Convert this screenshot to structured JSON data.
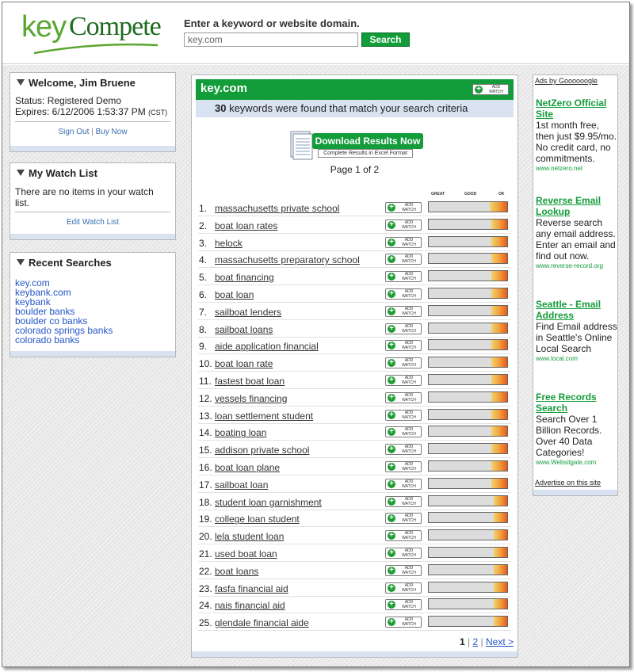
{
  "header": {
    "logo_key": "key",
    "logo_compete": "Compete",
    "search_label": "Enter a keyword or website domain.",
    "search_value": "key.com",
    "search_button": "Search"
  },
  "welcome": {
    "title": "Welcome, Jim Bruene",
    "status_line": "Status:  Registered Demo",
    "expires_line": "Expires: 6/12/2006 1:53:37 PM",
    "tz": "(CST)",
    "sign_out": "Sign Out",
    "separator": "|",
    "buy_now": "Buy Now"
  },
  "watchlist": {
    "title": "My Watch List",
    "empty_text": "There are no items in your watch list.",
    "edit_link": "Edit Watch List"
  },
  "recent": {
    "title": "Recent Searches",
    "items": [
      "key.com",
      "keybank.com",
      "keybank",
      "boulder banks",
      "boulder co banks",
      "colorado springs banks",
      "colorado banks"
    ]
  },
  "results": {
    "domain": "key.com",
    "add_watch_l1": "ADD",
    "add_watch_l2": "WATCH",
    "count": "30",
    "count_suffix": " keywords were found that match your search criteria",
    "download_button": "Download Results Now",
    "download_sub": "Complete Results in Excel Format",
    "page_text": "Page 1 of 2",
    "meter_labels": [
      "GREAT",
      "GOOD",
      "OK"
    ],
    "rows": [
      {
        "num": "1.",
        "kw": "massachusetts private school",
        "level": 0.22
      },
      {
        "num": "2.",
        "kw": "boat loan rates",
        "level": 0.2
      },
      {
        "num": "3.",
        "kw": "helock",
        "level": 0.2
      },
      {
        "num": "4.",
        "kw": "massachusetts preparatory school",
        "level": 0.2
      },
      {
        "num": "5.",
        "kw": "boat financing",
        "level": 0.2
      },
      {
        "num": "6.",
        "kw": "boat loan",
        "level": 0.2
      },
      {
        "num": "7.",
        "kw": "sailboat lenders",
        "level": 0.2
      },
      {
        "num": "8.",
        "kw": "sailboat loans",
        "level": 0.2
      },
      {
        "num": "9.",
        "kw": "aide application financial",
        "level": 0.2
      },
      {
        "num": "10.",
        "kw": "boat loan rate",
        "level": 0.2
      },
      {
        "num": "11.",
        "kw": "fastest boat loan",
        "level": 0.2
      },
      {
        "num": "12.",
        "kw": "vessels financing",
        "level": 0.2
      },
      {
        "num": "13.",
        "kw": "loan settlement student",
        "level": 0.2
      },
      {
        "num": "14.",
        "kw": "boating loan",
        "level": 0.2
      },
      {
        "num": "15.",
        "kw": "addison private school",
        "level": 0.2
      },
      {
        "num": "16.",
        "kw": "boat loan plane",
        "level": 0.2
      },
      {
        "num": "17.",
        "kw": "sailboat loan",
        "level": 0.2
      },
      {
        "num": "18.",
        "kw": "student loan garnishment",
        "level": 0.17
      },
      {
        "num": "19.",
        "kw": "college loan student",
        "level": 0.17
      },
      {
        "num": "20.",
        "kw": "lela student loan",
        "level": 0.17
      },
      {
        "num": "21.",
        "kw": "used boat loan",
        "level": 0.17
      },
      {
        "num": "22.",
        "kw": "boat loans",
        "level": 0.17
      },
      {
        "num": "23.",
        "kw": "fasfa financial aid",
        "level": 0.17
      },
      {
        "num": "24.",
        "kw": "nais financial aid",
        "level": 0.17
      },
      {
        "num": "25.",
        "kw": "glendale financial aide",
        "level": 0.17
      }
    ],
    "pager_current": "1",
    "pager_sep": "|",
    "pager_page2": "2",
    "pager_next": "Next >"
  },
  "ads": {
    "ads_by": "Ads by Goooooogle",
    "items": [
      {
        "title": "NetZero Official Site",
        "desc": "1st month free, then just $9.95/mo. No credit card, no commitments.",
        "url": "www.netzero.net"
      },
      {
        "title": "Reverse Email Lookup",
        "desc": "Reverse search any email address. Enter an email and find out now.",
        "url": "www.reverse-record.org"
      },
      {
        "title": "Seattle - Email Address",
        "desc": "Find Email address in Seattle's Online Local Search",
        "url": "www.local.com"
      },
      {
        "title": "Free Records Search",
        "desc": "Search Over 1 Billion Records. Over 40 Data Categories!",
        "url": "www.Websitgate.com"
      }
    ],
    "advertise": "Advertise on this site"
  },
  "colors": {
    "green": "#139c3a",
    "link_blue": "#2355c8",
    "panel_blue": "#d8e2f0"
  }
}
